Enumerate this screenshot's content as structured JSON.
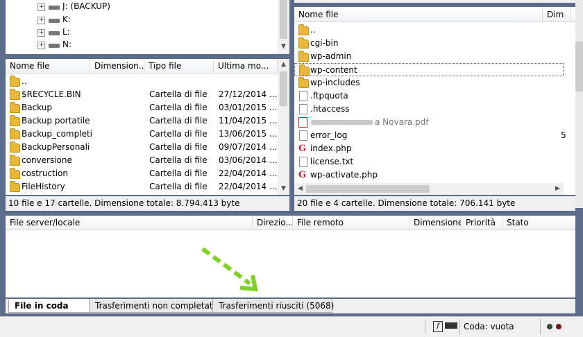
{
  "local_tree": {
    "items": [
      {
        "label": "J: (BACKUP)"
      },
      {
        "label": "K:"
      },
      {
        "label": "L:"
      },
      {
        "label": "N:"
      }
    ]
  },
  "local_list": {
    "columns": [
      "Nome file",
      "Dimension...",
      "Tipo file",
      "Ultima mo..."
    ],
    "rows": [
      {
        "name": "..",
        "type": "",
        "date": ""
      },
      {
        "name": "$RECYCLE.BIN",
        "type": "Cartella di file",
        "date": "27/12/2014 ..."
      },
      {
        "name": "Backup",
        "type": "Cartella di file",
        "date": "03/01/2015 ..."
      },
      {
        "name": "Backup portatile",
        "type": "Cartella di file",
        "date": "11/04/2015 ..."
      },
      {
        "name": "Backup_completi",
        "type": "Cartella di file",
        "date": "13/06/2015 ..."
      },
      {
        "name": "BackupPersonali",
        "type": "Cartella di file",
        "date": "09/07/2014 ..."
      },
      {
        "name": "conversione",
        "type": "Cartella di file",
        "date": "03/06/2014 ..."
      },
      {
        "name": "costruction",
        "type": "Cartella di file",
        "date": "22/04/2014 ..."
      },
      {
        "name": "FileHistory",
        "type": "Cartella di file",
        "date": "22/04/2014 ..."
      }
    ],
    "status": "10 file e 17 cartelle. Dimensione totale: 8.794.413 byte"
  },
  "remote_list": {
    "columns": [
      "Nome file",
      "Dim"
    ],
    "rows": [
      {
        "name": "..",
        "icon": "folder-icon"
      },
      {
        "name": "cgi-bin",
        "icon": "folder-icon"
      },
      {
        "name": "wp-admin",
        "icon": "folder-icon"
      },
      {
        "name": "wp-content",
        "icon": "folder-icon"
      },
      {
        "name": "wp-includes",
        "icon": "folder-icon"
      },
      {
        "name": ".ftpquota",
        "icon": "file-icon"
      },
      {
        "name": ".htaccess",
        "icon": "file-icon"
      },
      {
        "name": "a Novara.pdf",
        "icon": "pdf-icon"
      },
      {
        "name": "error_log",
        "icon": "file-icon",
        "size": "5"
      },
      {
        "name": "index.php",
        "icon": "php-icon"
      },
      {
        "name": "license.txt",
        "icon": "file-icon"
      },
      {
        "name": "wp-activate.php",
        "icon": "php-icon"
      }
    ],
    "status": "20 file e 4 cartelle. Dimensione totale: 706.141 byte"
  },
  "queue": {
    "columns": [
      "File server/locale",
      "Direzio...",
      "File remoto",
      "Dimensione",
      "Priorità",
      "Stato"
    ]
  },
  "tabs": [
    {
      "label": "File in coda"
    },
    {
      "label": "Trasferimenti non completati"
    },
    {
      "label": "Trasferimenti riusciti (5068)"
    }
  ],
  "statusbar": {
    "queue_label": "Coda: vuota"
  },
  "colors": {
    "arrow": "#7ed321",
    "folder": "#e9b83a",
    "selection": "#3399ff"
  }
}
